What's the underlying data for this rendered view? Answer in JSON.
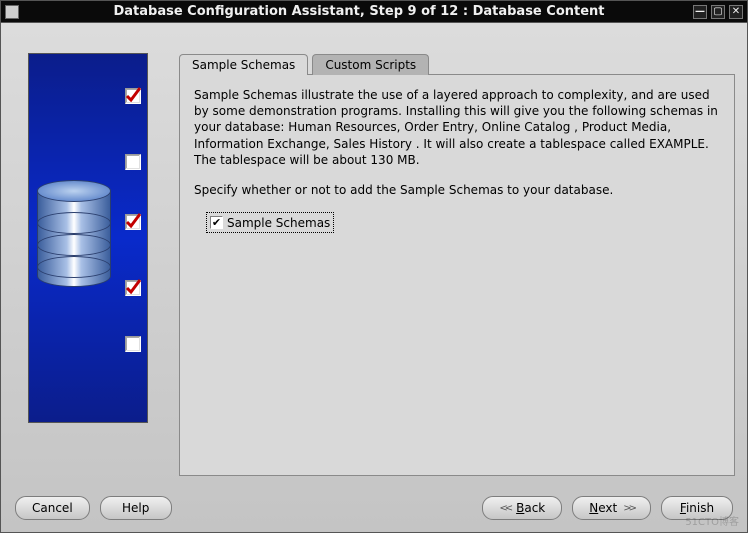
{
  "window": {
    "title": "Database Configuration Assistant, Step 9 of 12 : Database Content"
  },
  "sidebar": {
    "steps": [
      {
        "checked": true
      },
      {
        "checked": false
      },
      {
        "checked": true
      },
      {
        "checked": true
      },
      {
        "checked": false
      }
    ]
  },
  "tabs": {
    "sample": "Sample Schemas",
    "custom": "Custom Scripts"
  },
  "body": {
    "paragraph1": "Sample Schemas illustrate the use of a layered approach to complexity, and are used by some demonstration programs. Installing this will give you the following schemas in your database: Human Resources, Order Entry, Online Catalog , Product Media, Information Exchange, Sales History . It will also create a tablespace called EXAMPLE. The tablespace will be about 130 MB.",
    "paragraph2": "Specify whether or not to add the Sample Schemas to your database.",
    "checkbox_label": "Sample Schemas"
  },
  "buttons": {
    "cancel": "Cancel",
    "help": "Help",
    "back_m": "B",
    "back_rest": "ack",
    "next_m": "N",
    "next_rest": "ext",
    "finish_m": "F",
    "finish_rest": "inish"
  }
}
